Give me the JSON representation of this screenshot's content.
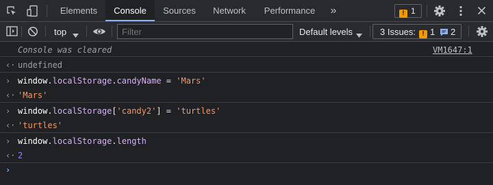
{
  "toolbar_tabs": {
    "elements": "Elements",
    "console": "Console",
    "sources": "Sources",
    "network": "Network",
    "performance": "Performance",
    "more": "»"
  },
  "header_right": {
    "issues_count": "1"
  },
  "console_toolbar": {
    "context": "top",
    "filter_placeholder": "Filter",
    "levels": "Default levels",
    "issues_label": "3 Issues:",
    "issues_warnings": "1",
    "issues_info": "2"
  },
  "console": {
    "cleared_message": "Console was cleared",
    "cleared_source": "VM1647:1",
    "undefined_result": "undefined",
    "line1": {
      "obj": "window",
      "dot1": ".",
      "prop1": "localStorage",
      "dot2": ".",
      "prop2": "candyName",
      "op": " = ",
      "value": "'Mars'"
    },
    "result1": "'Mars'",
    "line2": {
      "obj": "window",
      "dot1": ".",
      "prop1": "localStorage",
      "open": "[",
      "key": "'candy2'",
      "close": "]",
      "op": " = ",
      "value": "'turtles'"
    },
    "result2": "'turtles'",
    "line3": {
      "obj": "window",
      "dot1": ".",
      "prop1": "localStorage",
      "dot2": ".",
      "prop2": "length"
    },
    "result3": "2"
  },
  "glyphs": {
    "prompt": "›",
    "result": "‹·",
    "caret": "›"
  },
  "icons": [
    "inspect-icon",
    "device-toggle-icon",
    "more-tabs-icon",
    "warning-badge-icon",
    "settings-gear-icon",
    "kebab-menu-icon",
    "sidebar-toggle-icon",
    "clear-console-icon",
    "eye-icon",
    "dropdown-arrow-icon"
  ],
  "colors": {
    "background": "#202124",
    "toolbar": "#292a2d",
    "accent_blue": "#8ab4f8",
    "warning_orange": "#f29900",
    "string": "#f29766",
    "property": "#d7aefb",
    "number": "#9980ff"
  }
}
